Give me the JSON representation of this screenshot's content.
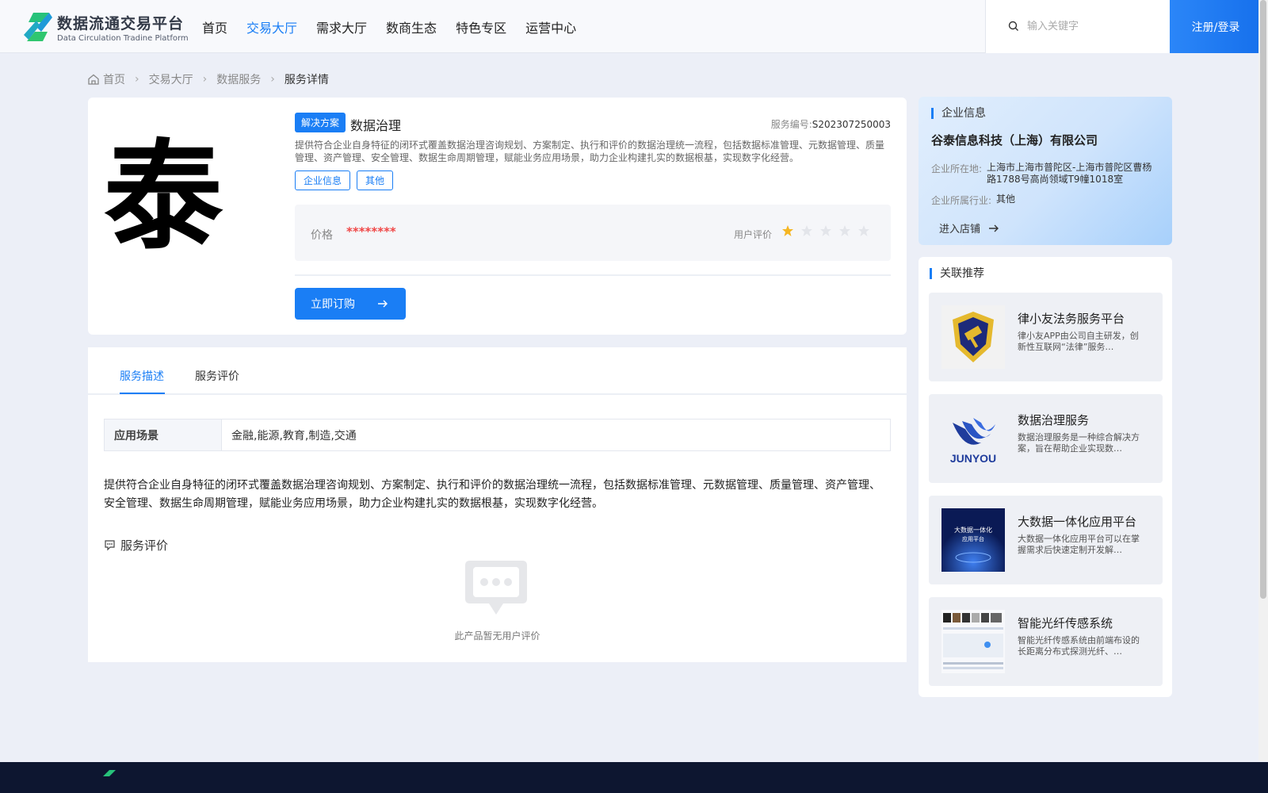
{
  "header": {
    "logo_cn": "数据流通交易平台",
    "logo_en": "Data Circulation Tradine Platform",
    "nav": [
      "首页",
      "交易大厅",
      "需求大厅",
      "数商生态",
      "特色专区",
      "运营中心"
    ],
    "active_nav": "交易大厅",
    "search_placeholder": "输入关键字",
    "login_label": "注册/登录"
  },
  "breadcrumb": {
    "home": "首页",
    "level1": "交易大厅",
    "level2": "数据服务",
    "current": "服务详情"
  },
  "product": {
    "image_glyph": "泰",
    "tag": "解决方案",
    "name": "数据治理",
    "service_no_label": "服务编号:",
    "service_no": "S202307250003",
    "description": "提供符合企业自身特征的闭环式覆盖数据治理咨询规划、方案制定、执行和评价的数据治理统一流程，包括数据标准管理、元数据管理、质量管理、资产管理、安全管理、数据生命周期管理，赋能业务应用场景，助力企业构建扎实的数据根基，实现数字化经营。",
    "chips": [
      "企业信息",
      "其他"
    ],
    "price_label": "价格",
    "price_value": "********",
    "rating_label": "用户评价",
    "rating": 1,
    "rating_max": 5,
    "buy_label": "立即订购"
  },
  "company": {
    "title": "企业信息",
    "name": "谷泰信息科技（上海）有限公司",
    "location_label": "企业所在地:",
    "location": "上海市上海市普陀区-上海市普陀区曹杨路1788号高尚领域T9幢1018室",
    "industry_label": "企业所属行业:",
    "industry": "其他",
    "enter_shop_label": "进入店铺"
  },
  "related": {
    "title": "关联推荐",
    "items": [
      {
        "title": "律小友法务服务平台",
        "desc": "律小友APP由公司自主研发，创新性互联网“法律”服务…"
      },
      {
        "title": "数据治理服务",
        "desc": "数据治理服务是一种综合解决方案，旨在帮助企业实现数…",
        "logo_text": "JUNYOU"
      },
      {
        "title": "大数据一体化应用平台",
        "desc": "大数据一体化应用平台可以在掌握需求后快速定制开发解…",
        "img_line1": "大数据一体化",
        "img_line2": "应用平台"
      },
      {
        "title": "智能光纤传感系统",
        "desc": "智能光纤传感系统由前端布设的长距离分布式探测光纤、…"
      }
    ]
  },
  "tabs": {
    "items": [
      "服务描述",
      "服务评价"
    ],
    "active": "服务描述"
  },
  "details": {
    "scene_label": "应用场景",
    "scene_value": "金融,能源,教育,制造,交通",
    "long_description": "提供符合企业自身特征的闭环式覆盖数据治理咨询规划、方案制定、执行和评价的数据治理统一流程，包括数据标准管理、元数据管理、质量管理、资产管理、安全管理、数据生命周期管理，赋能业务应用场景，助力企业构建扎实的数据根基，实现数字化经营。",
    "review_title": "服务评价",
    "empty_text": "此产品暂无用户评价"
  },
  "colors": {
    "accent": "#1a7ef5",
    "price": "#f04848",
    "star_on": "#f5b623",
    "star_off": "#e3e5ea",
    "footer": "#0d1630"
  }
}
